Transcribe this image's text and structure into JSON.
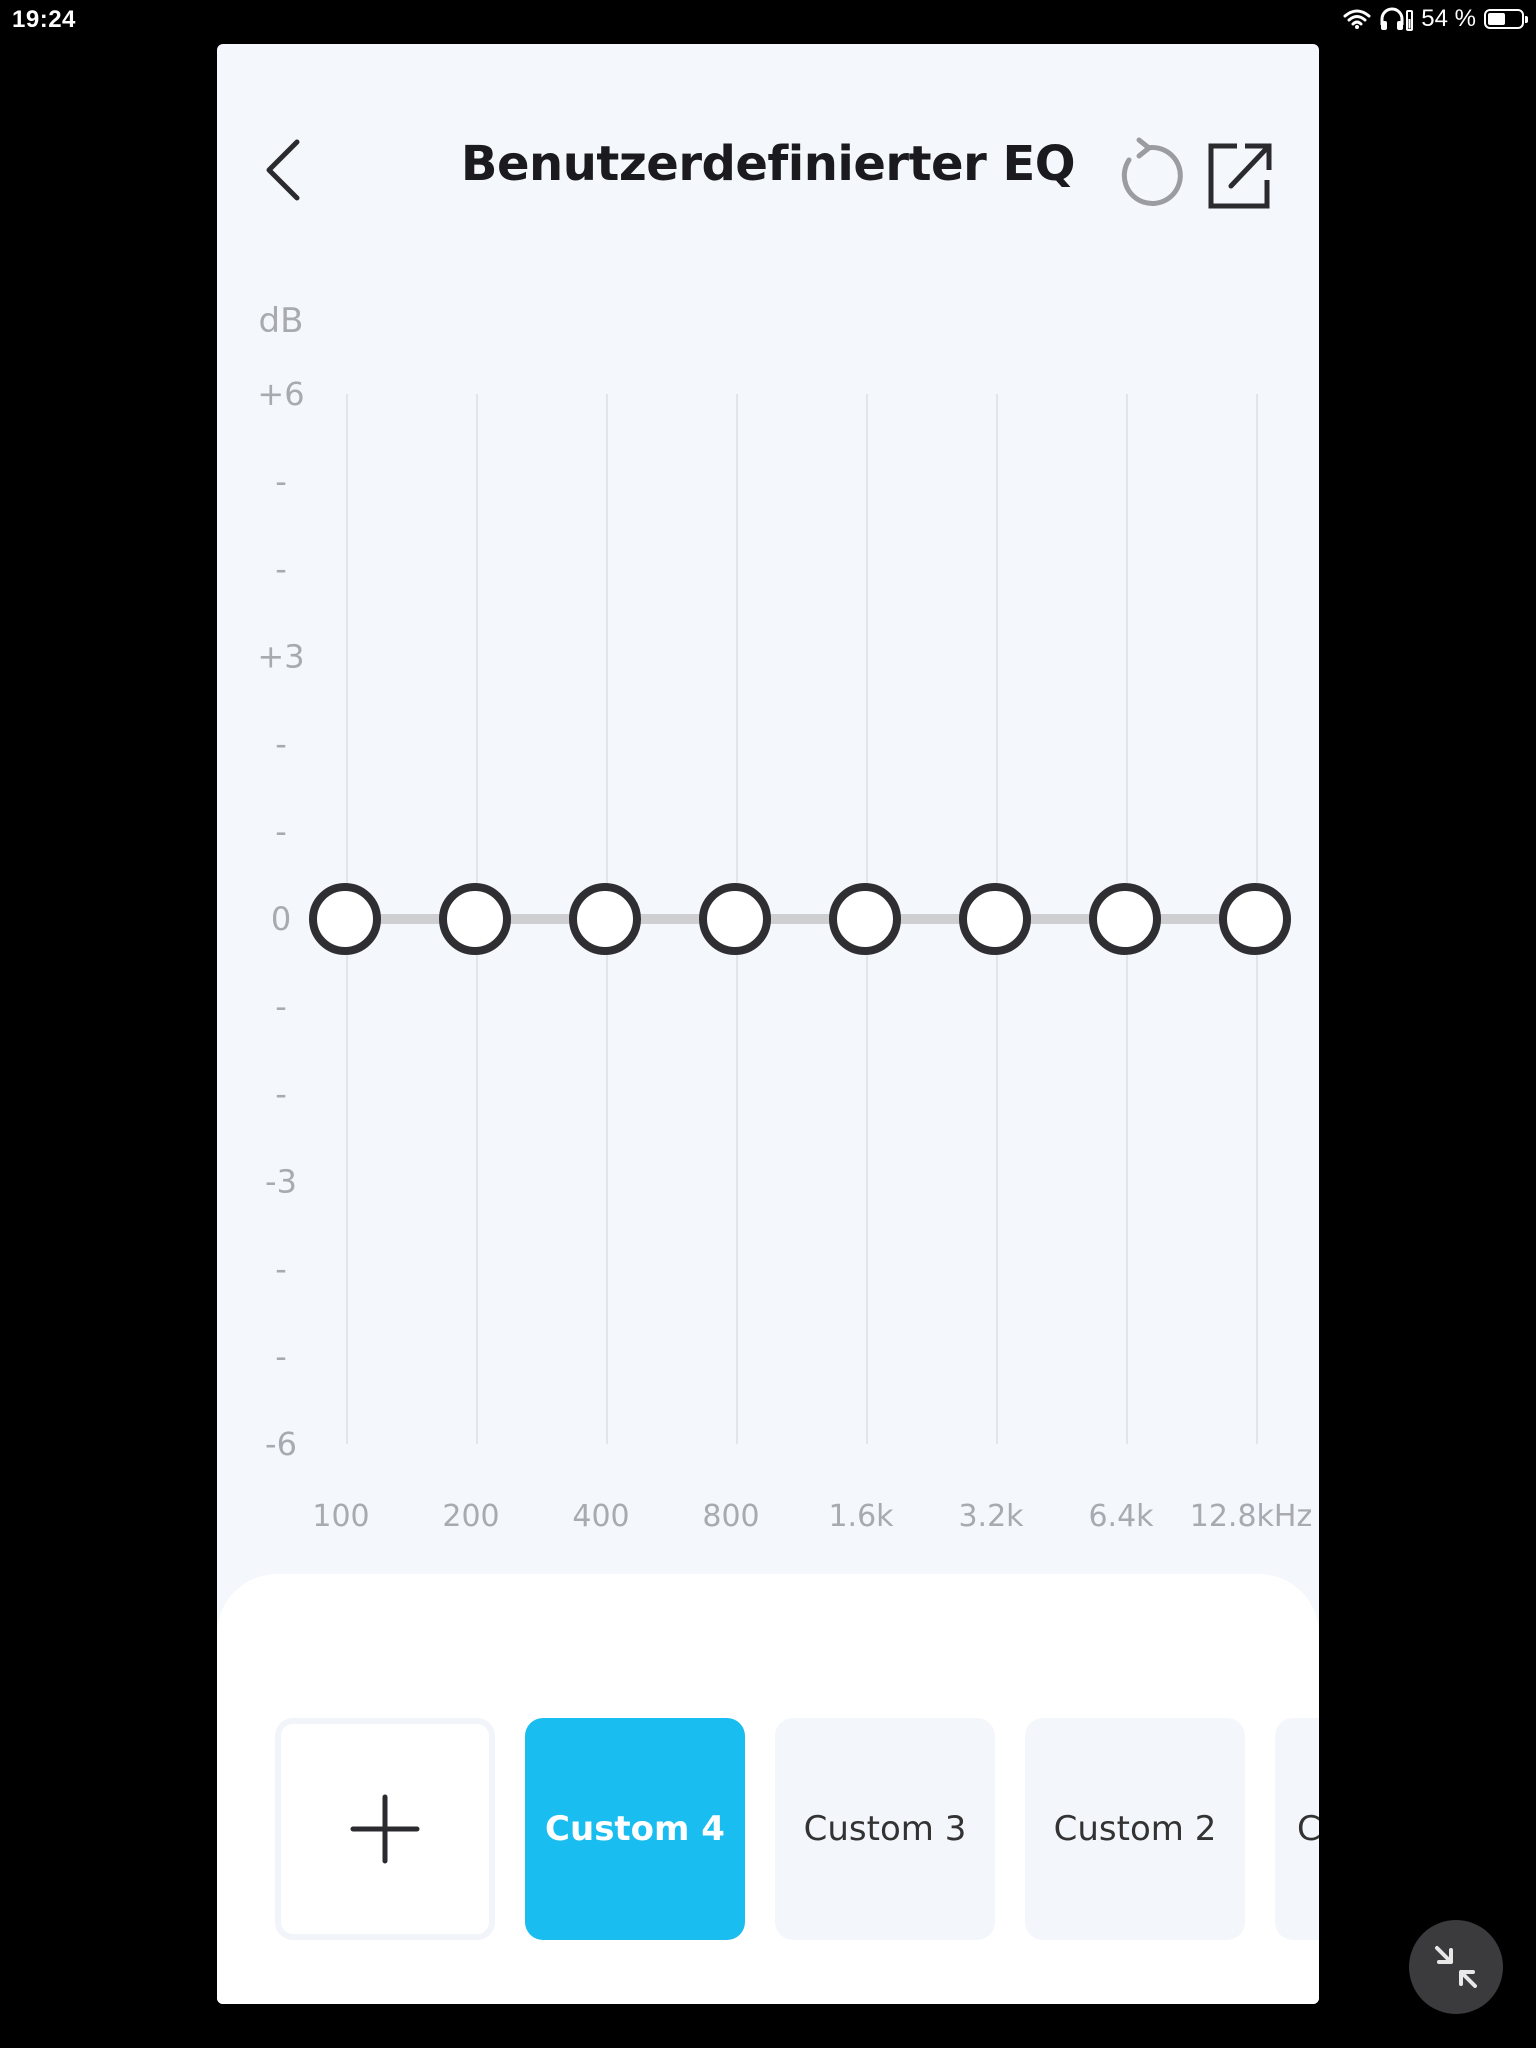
{
  "status_bar": {
    "time": "19:24",
    "battery_text": "54 %",
    "battery_level_percent": 54,
    "icons": [
      "wifi-icon",
      "headphones-icon",
      "battery-icon"
    ]
  },
  "header": {
    "title": "Benutzerdefinierter EQ",
    "back_icon": "chevron-left-icon",
    "reset_icon": "reset-icon",
    "export_icon": "export-icon"
  },
  "equalizer": {
    "y_unit_label": "dB",
    "y_axis_labels": [
      "+6",
      "-",
      "-",
      "+3",
      "-",
      "-",
      "0",
      "-",
      "-",
      "-3",
      "-",
      "-",
      "-6"
    ],
    "y_range": [
      -6,
      6
    ],
    "bands": [
      {
        "label": "100",
        "gain": 0
      },
      {
        "label": "200",
        "gain": 0
      },
      {
        "label": "400",
        "gain": 0
      },
      {
        "label": "800",
        "gain": 0
      },
      {
        "label": "1.6k",
        "gain": 0
      },
      {
        "label": "3.2k",
        "gain": 0
      },
      {
        "label": "6.4k",
        "gain": 0
      },
      {
        "label": "12.8kHz",
        "gain": 0
      }
    ],
    "colors": {
      "grid": "#e2e5ea",
      "curve": "#cfcfd2",
      "knob": "#2f2f33",
      "axis_text": "#a7aab0"
    }
  },
  "presets": {
    "add_icon": "plus-icon",
    "items": [
      {
        "label": "Custom 4",
        "active": true
      },
      {
        "label": "Custom 3",
        "active": false
      },
      {
        "label": "Custom 2",
        "active": false
      },
      {
        "label": "C",
        "active": false
      }
    ],
    "accent_color": "#19bdf0"
  },
  "fab": {
    "icon": "collapse-icon"
  }
}
